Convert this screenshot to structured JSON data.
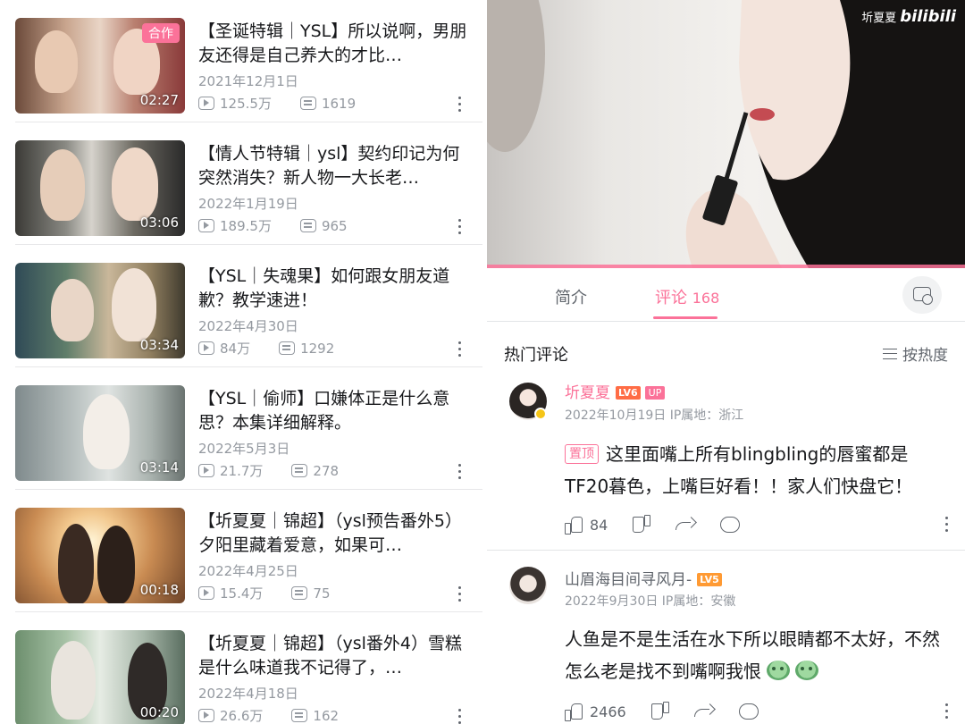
{
  "colors": {
    "accent": "#fb7299",
    "text": "#18191c",
    "muted": "#9499a0"
  },
  "videos": [
    {
      "title": "【圣诞特辑｜YSL】所以说啊，男朋友还得是自己养大的才比…",
      "date": "2021年12月1日",
      "views": "125.5万",
      "danmaku": "1619",
      "duration": "02:27",
      "badge": "合作"
    },
    {
      "title": "【情人节特辑｜ysl】契约印记为何突然消失？新人物一大长老…",
      "date": "2022年1月19日",
      "views": "189.5万",
      "danmaku": "965",
      "duration": "03:06"
    },
    {
      "title": "【YSL｜失魂果】如何跟女朋友道歉？教学速进！",
      "date": "2022年4月30日",
      "views": "84万",
      "danmaku": "1292",
      "duration": "03:34"
    },
    {
      "title": "【YSL｜偷师】口嫌体正是什么意思？本集详细解释。",
      "date": "2022年5月3日",
      "views": "21.7万",
      "danmaku": "278",
      "duration": "03:14"
    },
    {
      "title": "【圻夏夏｜锦超】（ysl预告番外5）夕阳里藏着爱意，如果可…",
      "date": "2022年4月25日",
      "views": "15.4万",
      "danmaku": "75",
      "duration": "00:18"
    },
    {
      "title": "【圻夏夏｜锦超】（ysl番外4）雪糕是什么味道我不记得了，…",
      "date": "2022年4月18日",
      "views": "26.6万",
      "danmaku": "162",
      "duration": "00:20"
    }
  ],
  "player": {
    "watermark_user": "圻夏夏",
    "watermark_logo": "bilibili"
  },
  "tabs": {
    "intro": "简介",
    "comments": "评论",
    "comment_count": "168"
  },
  "comments_section": {
    "title": "热门评论",
    "sort": "按热度"
  },
  "comments": [
    {
      "user": "圻夏夏",
      "level": "LV6",
      "up": "UP",
      "meta": "2022年10月19日  IP属地：浙江",
      "pinned": "置顶",
      "text": "这里面嘴上所有blingbling的唇蜜都是TF20暮色，上嘴巨好看！！家人们快盘它！",
      "likes": "84"
    },
    {
      "user": "山眉海目间寻风月-",
      "level": "LV5",
      "meta": "2022年9月30日  IP属地：安徽",
      "text": "人鱼是不是生活在水下所以眼睛都不太好，不然怎么老是找不到嘴啊我恨",
      "likes": "2466"
    }
  ]
}
